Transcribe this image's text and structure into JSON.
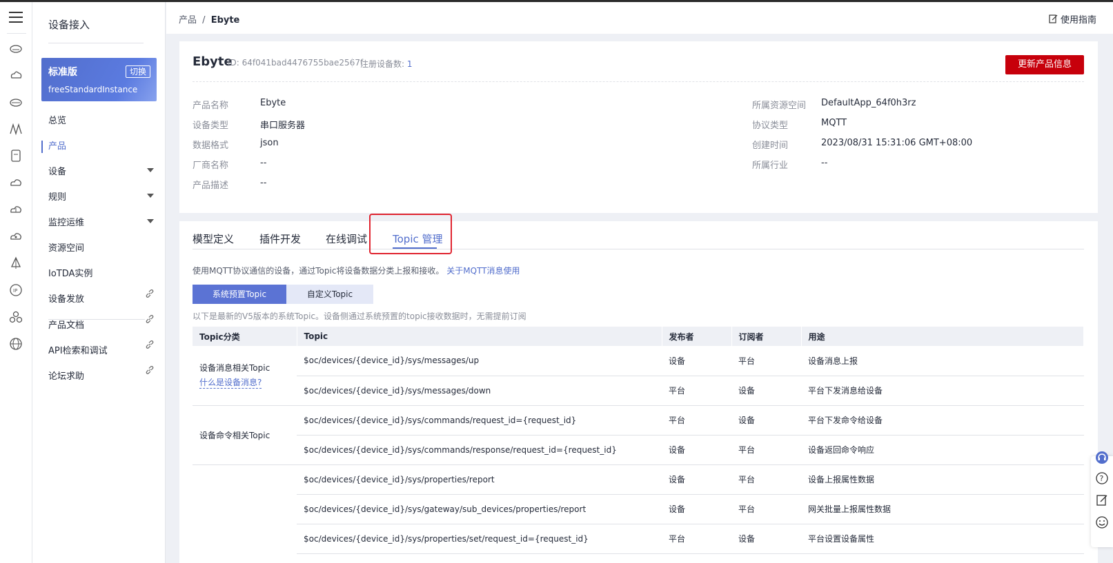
{
  "sidebar": {
    "title": "设备接入",
    "instance": {
      "name": "标准版",
      "switch_label": "切换",
      "id": "freeStandardInstance"
    },
    "items": [
      {
        "label": "总览"
      },
      {
        "label": "产品"
      },
      {
        "label": "设备"
      },
      {
        "label": "规则"
      },
      {
        "label": "监控运维"
      },
      {
        "label": "资源空间"
      },
      {
        "label": "IoTDA实例"
      },
      {
        "label": "设备发放"
      },
      {
        "label": "产品文档"
      },
      {
        "label": "API检索和调试"
      },
      {
        "label": "论坛求助"
      }
    ]
  },
  "header": {
    "crumb_parent": "产品",
    "crumb_sep": "/",
    "crumb_current": "Ebyte",
    "guide_label": "使用指南"
  },
  "product": {
    "name": "Ebyte",
    "id_text": "ID: 64f041bad4476755bae2567f",
    "reg_label": "注册设备数:",
    "reg_count": "1",
    "update_button": "更新产品信息",
    "left_fields": [
      {
        "k": "产品名称",
        "v": "Ebyte"
      },
      {
        "k": "设备类型",
        "v": "串口服务器"
      },
      {
        "k": "数据格式",
        "v": "json"
      },
      {
        "k": "厂商名称",
        "v": "--"
      },
      {
        "k": "产品描述",
        "v": "--"
      }
    ],
    "right_fields": [
      {
        "k": "所属资源空间",
        "v": "DefaultApp_64f0h3rz"
      },
      {
        "k": "协议类型",
        "v": "MQTT"
      },
      {
        "k": "创建时间",
        "v": "2023/08/31 15:31:06 GMT+08:00"
      },
      {
        "k": "所属行业",
        "v": "--"
      }
    ]
  },
  "tabs": [
    "模型定义",
    "插件开发",
    "在线调试",
    "Topic 管理"
  ],
  "topic": {
    "intro": "使用MQTT协议通信的设备，通过Topic将设备数据分类上报和接收。",
    "intro_link": "关于MQTT消息使用",
    "seg_on": "系统预置Topic",
    "seg_off": "自定义Topic",
    "note": "以下是最新的V5版本的系统Topic。设备侧通过系统预置的topic接收数据时，无需提前订阅",
    "headers": [
      "Topic分类",
      "Topic",
      "发布者",
      "订阅者",
      "用途"
    ],
    "cat_msg": "设备消息相关Topic",
    "cat_msg_link": "什么是设备消息?",
    "cat_cmd": "设备命令相关Topic",
    "rows": [
      {
        "topic": "$oc/devices/{device_id}/sys/messages/up",
        "pub": "设备",
        "sub": "平台",
        "use": "设备消息上报"
      },
      {
        "topic": "$oc/devices/{device_id}/sys/messages/down",
        "pub": "平台",
        "sub": "设备",
        "use": "平台下发消息给设备"
      },
      {
        "topic": "$oc/devices/{device_id}/sys/commands/request_id={request_id}",
        "pub": "平台",
        "sub": "设备",
        "use": "平台下发命令给设备"
      },
      {
        "topic": "$oc/devices/{device_id}/sys/commands/response/request_id={request_id}",
        "pub": "设备",
        "sub": "平台",
        "use": "设备返回命令响应"
      },
      {
        "topic": "$oc/devices/{device_id}/sys/properties/report",
        "pub": "设备",
        "sub": "平台",
        "use": "设备上报属性数据"
      },
      {
        "topic": "$oc/devices/{device_id}/sys/gateway/sub_devices/properties/report",
        "pub": "设备",
        "sub": "平台",
        "use": "网关批量上报属性数据"
      },
      {
        "topic": "$oc/devices/{device_id}/sys/properties/set/request_id={request_id}",
        "pub": "平台",
        "sub": "设备",
        "use": "平台设置设备属性"
      }
    ]
  },
  "colors": {
    "accent": "#526ecc",
    "danger": "#c7000b",
    "highlight": "#e0242f"
  }
}
